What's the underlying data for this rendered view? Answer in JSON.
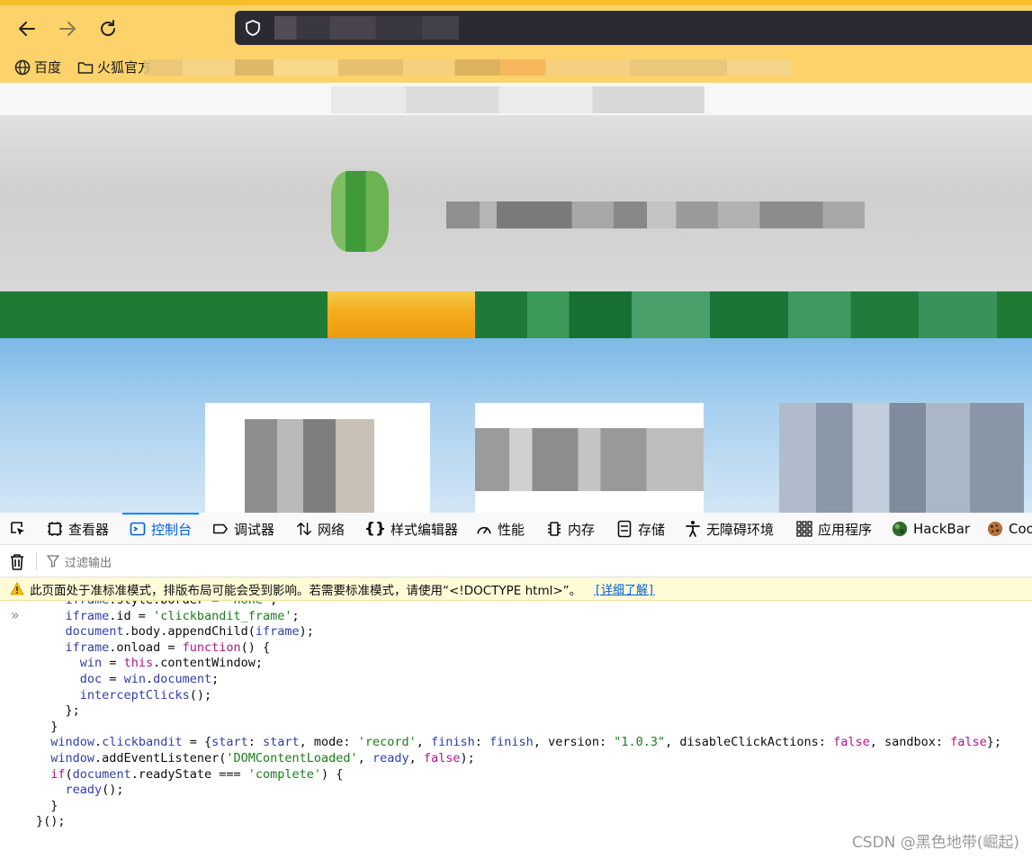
{
  "chrome": {
    "bookmarks": [
      {
        "label": "百度",
        "icon": "globe-icon"
      },
      {
        "label": "火狐官方",
        "icon": "folder-icon"
      }
    ]
  },
  "devtools": {
    "tabs": [
      {
        "label": "",
        "icon": "element-picker-icon"
      },
      {
        "label": "查看器",
        "icon": "inspector-icon"
      },
      {
        "label": "控制台",
        "icon": "console-icon",
        "active": true
      },
      {
        "label": "调试器",
        "icon": "debugger-icon"
      },
      {
        "label": "网络",
        "icon": "network-icon"
      },
      {
        "label": "样式编辑器",
        "icon": "style-editor-icon"
      },
      {
        "label": "性能",
        "icon": "performance-icon"
      },
      {
        "label": "内存",
        "icon": "memory-icon"
      },
      {
        "label": "存储",
        "icon": "storage-icon"
      },
      {
        "label": "无障碍环境",
        "icon": "accessibility-icon"
      },
      {
        "label": "应用程序",
        "icon": "application-icon"
      },
      {
        "label": "HackBar",
        "icon": "hackbar-icon"
      },
      {
        "label": "Coo",
        "icon": "cookie-icon"
      }
    ],
    "filter_placeholder": "过滤输出",
    "warning": {
      "text": "此页面处于准标准模式，排版布局可能会受到影响。若需要标准模式，请使用“<!DOCTYPE html>”。",
      "link": "[详细了解]"
    },
    "prompt": "»",
    "code_lines": [
      "    iframe.style.border = 'none';",
      "    iframe.id = 'clickbandit_frame';",
      "    document.body.appendChild(iframe);",
      "    iframe.onload = function() {",
      "      win = this.contentWindow;",
      "      doc = win.document;",
      "      interceptClicks();",
      "    };",
      "  }",
      "  window.clickbandit = {start: start, mode: 'record', finish: finish, version: \"1.0.3\", disableClickActions: false, sandbox: false};",
      "  window.addEventListener('DOMContentLoaded', ready, false);",
      "  if(document.readyState === 'complete') {",
      "    ready();",
      "  }",
      "}();"
    ]
  },
  "watermark": "CSDN @黑色地带(崛起)"
}
